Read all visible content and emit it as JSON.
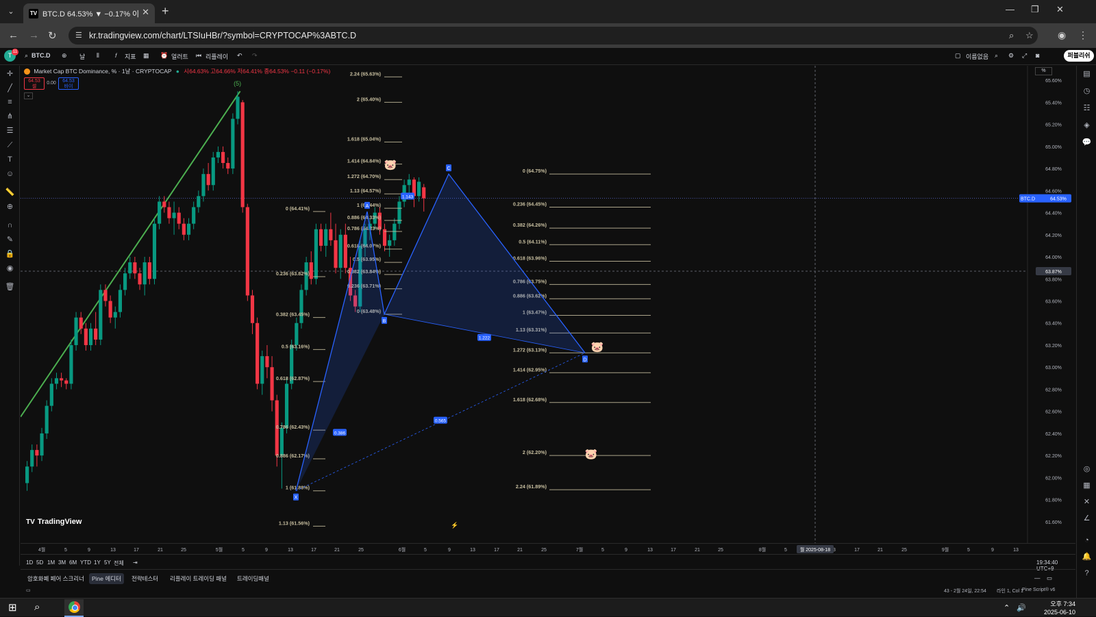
{
  "browser": {
    "tab_title": "BTC.D 64.53% ▼ −0.17% 이름",
    "url": "kr.tradingview.com/chart/LTSIuHBr/?symbol=CRYPTOCAP%3ABTC.D",
    "new_tab": "+"
  },
  "tv_header": {
    "avatar_badge": "11",
    "symbol": "BTC.D",
    "interval": "날",
    "indicators": "지표",
    "alerts": "얼러트",
    "replay": "리플레이",
    "autosave": "이름없음",
    "publish": "퍼블리쉬"
  },
  "legend": {
    "title": "Market Cap BTC Dominance, % · 1날 · CRYPTOCAP",
    "ohlc": "시64.63% 고64.66% 저64.41% 종64.53% −0.11 (−0.17%)",
    "sell_price": "64.53",
    "sell_label": "셀",
    "spread": "0.00",
    "buy_price": "64.53",
    "buy_label": "바이"
  },
  "price_axis": {
    "ticks": [
      "65.60%",
      "65.40%",
      "65.20%",
      "65.00%",
      "64.80%",
      "64.60%",
      "64.40%",
      "64.20%",
      "64.00%",
      "63.80%",
      "63.60%",
      "63.40%",
      "63.20%",
      "63.00%",
      "62.80%",
      "62.60%",
      "62.40%",
      "62.20%",
      "62.00%",
      "61.80%",
      "61.60%"
    ],
    "symbol_tag": "BTC.D",
    "symbol_price": "64.53%",
    "crosshair_price": "63.87%",
    "scale_btn": "%"
  },
  "time_axis": {
    "ticks": [
      "4월",
      "5",
      "9",
      "13",
      "17",
      "21",
      "25",
      "5월",
      "5",
      "9",
      "13",
      "17",
      "21",
      "25",
      "6월",
      "5",
      "9",
      "13",
      "17",
      "21",
      "25",
      "7월",
      "5",
      "9",
      "13",
      "17",
      "21",
      "25",
      "8월",
      "5",
      "9",
      "13",
      "17",
      "21",
      "25",
      "9월",
      "5",
      "9",
      "13"
    ],
    "crosshair_date": "월 2025-08-18"
  },
  "chart_data": {
    "type": "candlestick",
    "wave_label": "(5)",
    "fib_left": [
      {
        "label": "2.24 (65.63%)",
        "price": 65.63
      },
      {
        "label": "2 (65.40%)",
        "price": 65.4
      },
      {
        "label": "1.618 (65.04%)",
        "price": 65.04
      },
      {
        "label": "1.414 (64.84%)",
        "price": 64.84
      },
      {
        "label": "1.272 (64.70%)",
        "price": 64.7
      },
      {
        "label": "1.13 (64.57%)",
        "price": 64.57
      },
      {
        "label": "1 (64.44%)",
        "price": 64.44
      },
      {
        "label": "0.886 (64.33%)",
        "price": 64.33
      },
      {
        "label": "0.786 (64.23%)",
        "price": 64.23
      },
      {
        "label": "0.618 (64.07%)",
        "price": 64.07
      },
      {
        "label": "0.5 (63.95%)",
        "price": 63.95
      },
      {
        "label": "0.382 (63.84%)",
        "price": 63.84
      },
      {
        "label": "0.236 (63.71%)",
        "price": 63.71
      },
      {
        "label": "0 (63.48%)",
        "price": 63.48
      }
    ],
    "fib_mid": [
      {
        "label": "0 (64.41%)",
        "price": 64.41
      },
      {
        "label": "0.236 (63.82%)",
        "price": 63.82
      },
      {
        "label": "0.382 (63.45%)",
        "price": 63.45
      },
      {
        "label": "0.5 (63.16%)",
        "price": 63.16
      },
      {
        "label": "0.618 (62.87%)",
        "price": 62.87
      },
      {
        "label": "0.786 (62.43%)",
        "price": 62.43
      },
      {
        "label": "0.886 (62.17%)",
        "price": 62.17
      },
      {
        "label": "1 (61.88%)",
        "price": 61.88
      },
      {
        "label": "1.13 (61.56%)",
        "price": 61.56
      }
    ],
    "fib_right": [
      {
        "label": "0 (64.75%)",
        "price": 64.75
      },
      {
        "label": "0.236 (64.45%)",
        "price": 64.45
      },
      {
        "label": "0.382 (64.26%)",
        "price": 64.26
      },
      {
        "label": "0.5 (64.11%)",
        "price": 64.11
      },
      {
        "label": "0.618 (63.96%)",
        "price": 63.96
      },
      {
        "label": "0.786 (63.75%)",
        "price": 63.75
      },
      {
        "label": "0.886 (63.62%)",
        "price": 63.62
      },
      {
        "label": "1 (63.47%)",
        "price": 63.47
      },
      {
        "label": "1.13 (63.31%)",
        "price": 63.31
      },
      {
        "label": "1.272 (63.13%)",
        "price": 63.13
      },
      {
        "label": "1.414 (62.95%)",
        "price": 62.95
      },
      {
        "label": "1.618 (62.68%)",
        "price": 62.68
      },
      {
        "label": "2 (62.20%)",
        "price": 62.2
      },
      {
        "label": "2.24 (61.89%)",
        "price": 61.89
      }
    ],
    "pattern_points": [
      {
        "label": "X",
        "price": 61.88
      },
      {
        "label": "A",
        "price": 64.41
      },
      {
        "label": "B",
        "price": 63.48
      },
      {
        "label": "C",
        "price": 64.75
      },
      {
        "label": "D",
        "price": 63.13
      }
    ],
    "pattern_ratios": [
      "0.386",
      "1.143",
      "1.222",
      "0.565"
    ],
    "candles": [
      [
        61.95,
        62.15,
        61.88,
        62.1
      ],
      [
        62.1,
        62.3,
        62.05,
        62.25
      ],
      [
        62.25,
        62.3,
        62.1,
        62.2
      ],
      [
        62.2,
        62.45,
        62.15,
        62.4
      ],
      [
        62.4,
        62.7,
        62.35,
        62.65
      ],
      [
        62.65,
        62.9,
        62.6,
        62.85
      ],
      [
        62.85,
        62.95,
        62.8,
        62.9
      ],
      [
        62.9,
        62.95,
        62.82,
        62.88
      ],
      [
        62.88,
        62.9,
        62.8,
        62.85
      ],
      [
        62.85,
        63.25,
        62.8,
        63.2
      ],
      [
        63.2,
        63.5,
        63.15,
        63.45
      ],
      [
        63.45,
        63.5,
        63.3,
        63.35
      ],
      [
        63.35,
        63.4,
        63.15,
        63.2
      ],
      [
        63.2,
        63.4,
        63.15,
        63.35
      ],
      [
        63.35,
        63.5,
        63.2,
        63.25
      ],
      [
        63.25,
        63.75,
        63.2,
        63.7
      ],
      [
        63.7,
        63.75,
        63.55,
        63.6
      ],
      [
        63.6,
        63.65,
        63.4,
        63.45
      ],
      [
        63.45,
        63.55,
        63.35,
        63.5
      ],
      [
        63.5,
        63.75,
        63.45,
        63.7
      ],
      [
        63.7,
        63.9,
        63.65,
        63.85
      ],
      [
        63.85,
        64.0,
        63.8,
        63.95
      ],
      [
        63.95,
        64.0,
        63.8,
        63.85
      ],
      [
        63.85,
        63.9,
        63.7,
        63.75
      ],
      [
        63.75,
        64.0,
        63.65,
        63.95
      ],
      [
        63.95,
        64.0,
        63.75,
        63.8
      ],
      [
        63.8,
        64.35,
        63.75,
        64.3
      ],
      [
        64.3,
        64.55,
        64.25,
        64.5
      ],
      [
        64.5,
        64.55,
        64.4,
        64.45
      ],
      [
        64.45,
        64.5,
        64.3,
        64.35
      ],
      [
        64.35,
        64.5,
        64.2,
        64.4
      ],
      [
        64.4,
        64.45,
        64.25,
        64.3
      ],
      [
        64.3,
        64.35,
        64.15,
        64.2
      ],
      [
        64.2,
        64.35,
        64.15,
        64.3
      ],
      [
        64.3,
        64.5,
        64.25,
        64.45
      ],
      [
        64.45,
        64.6,
        64.4,
        64.55
      ],
      [
        64.55,
        64.8,
        64.5,
        64.75
      ],
      [
        64.75,
        64.85,
        64.6,
        64.65
      ],
      [
        64.65,
        64.95,
        64.6,
        64.9
      ],
      [
        64.9,
        65.0,
        64.85,
        64.95
      ],
      [
        64.95,
        65.0,
        64.8,
        64.85
      ],
      [
        64.85,
        64.9,
        64.75,
        64.8
      ],
      [
        64.8,
        65.3,
        64.75,
        65.25
      ],
      [
        65.25,
        65.5,
        65.2,
        65.45
      ],
      [
        65.4,
        65.42,
        64.4,
        64.45
      ],
      [
        64.45,
        64.48,
        63.6,
        63.65
      ],
      [
        63.65,
        63.7,
        63.3,
        63.4
      ],
      [
        63.4,
        63.45,
        62.8,
        62.85
      ],
      [
        62.85,
        63.15,
        62.75,
        63.1
      ],
      [
        63.1,
        63.2,
        62.9,
        63.0
      ],
      [
        63.0,
        63.1,
        62.6,
        62.7
      ],
      [
        62.7,
        62.75,
        62.1,
        62.2
      ],
      [
        62.2,
        62.5,
        61.9,
        62.45
      ],
      [
        62.45,
        62.9,
        62.4,
        62.85
      ],
      [
        62.85,
        63.25,
        62.8,
        63.2
      ],
      [
        63.2,
        63.45,
        63.15,
        63.4
      ],
      [
        63.4,
        63.75,
        63.35,
        63.7
      ],
      [
        63.7,
        64.0,
        63.65,
        63.95
      ],
      [
        63.95,
        64.05,
        63.75,
        63.8
      ],
      [
        63.8,
        64.3,
        63.75,
        64.25
      ],
      [
        64.25,
        64.3,
        64.05,
        64.1
      ],
      [
        64.1,
        64.3,
        64.0,
        64.25
      ],
      [
        64.25,
        64.4,
        64.1,
        64.15
      ],
      [
        64.15,
        64.3,
        63.85,
        63.9
      ],
      [
        63.9,
        64.25,
        63.8,
        64.2
      ],
      [
        64.2,
        64.3,
        63.85,
        63.9
      ],
      [
        63.9,
        64.0,
        63.6,
        63.65
      ],
      [
        63.65,
        63.7,
        63.5,
        63.55
      ],
      [
        63.55,
        64.15,
        63.5,
        64.1
      ],
      [
        64.1,
        64.3,
        64.0,
        64.25
      ],
      [
        64.25,
        64.35,
        64.15,
        64.3
      ],
      [
        64.3,
        64.45,
        64.25,
        64.4
      ],
      [
        64.4,
        64.45,
        64.2,
        64.25
      ],
      [
        64.25,
        64.3,
        64.05,
        64.1
      ],
      [
        64.1,
        64.2,
        64.0,
        64.15
      ],
      [
        64.15,
        64.35,
        64.1,
        64.3
      ],
      [
        64.3,
        64.55,
        64.25,
        64.5
      ],
      [
        64.5,
        64.7,
        64.45,
        64.65
      ],
      [
        64.65,
        64.75,
        64.55,
        64.7
      ],
      [
        64.7,
        64.72,
        64.45,
        64.55
      ],
      [
        64.55,
        64.72,
        64.5,
        64.68
      ],
      [
        64.63,
        64.66,
        64.41,
        64.53
      ]
    ]
  },
  "range_bar": [
    "1D",
    "5D",
    "1M",
    "3M",
    "6M",
    "YTD",
    "1Y",
    "5Y",
    "전체"
  ],
  "utc_time": "19:34:40 UTC+9",
  "panels": [
    "암호화폐 페어 스크리너",
    "Pine 에디터",
    "전략테스터",
    "리플레이 트레이딩 패널",
    "트레이딩패널"
  ],
  "status": {
    "left": "43 - 2월 24일, 22:54",
    "line": "라인 1, Col 1",
    "pine": "Pine Script® v6"
  },
  "taskbar": {
    "time": "오후 7:34",
    "date": "2025-06-10"
  },
  "colors": {
    "up": "#089981",
    "down": "#f23645",
    "pattern": "#2962ff",
    "fib": "#c8bfa0",
    "trend": "#4caf50"
  }
}
